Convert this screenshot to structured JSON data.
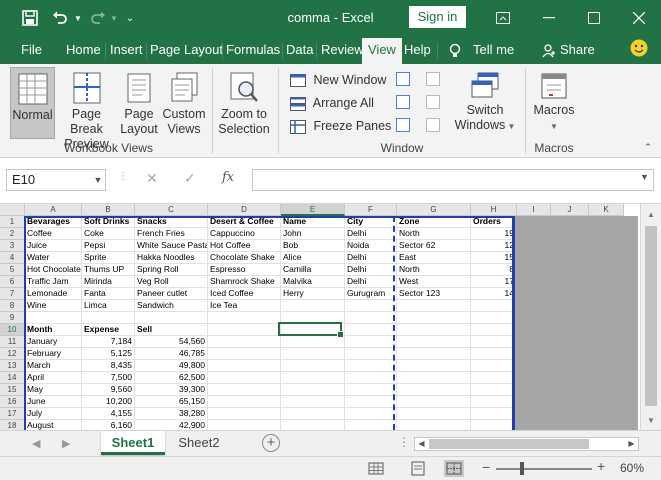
{
  "window": {
    "title": "comma",
    "separator": " - ",
    "app": "Excel",
    "signin_label": "Sign in"
  },
  "tabs": [
    {
      "label": "File"
    },
    {
      "label": "Home"
    },
    {
      "label": "Insert"
    },
    {
      "label": "Page Layout"
    },
    {
      "label": "Formulas"
    },
    {
      "label": "Data"
    },
    {
      "label": "Review"
    },
    {
      "label": "View"
    },
    {
      "label": "Help"
    },
    {
      "label": "Tell me"
    },
    {
      "label": "Share"
    }
  ],
  "ribbon": {
    "workbook_views": {
      "label": "Workbook Views",
      "normal": "Normal",
      "page_break_1": "Page Break",
      "page_break_2": "Preview",
      "page_layout_1": "Page",
      "page_layout_2": "Layout",
      "custom_views_1": "Custom",
      "custom_views_2": "Views"
    },
    "zoom": {
      "zoom_to_selection_1": "Zoom to",
      "zoom_to_selection_2": "Selection"
    },
    "window": {
      "label": "Window",
      "new_window": "New Window",
      "arrange_all": "Arrange All",
      "freeze_panes": "Freeze Panes",
      "switch_windows_1": "Switch",
      "switch_windows_2": "Windows"
    },
    "macros": {
      "label": "Macros",
      "macros_button": "Macros"
    }
  },
  "formula_bar": {
    "name_box": "E10",
    "formula": ""
  },
  "columns": [
    "A",
    "B",
    "C",
    "D",
    "E",
    "F",
    "G",
    "H",
    "I",
    "J",
    "K"
  ],
  "rows": [
    "1",
    "2",
    "3",
    "4",
    "5",
    "6",
    "7",
    "8",
    "9",
    "10",
    "11",
    "12",
    "13",
    "14",
    "15",
    "16",
    "17",
    "18"
  ],
  "selected": {
    "column": "E",
    "row": "10"
  },
  "sheet": {
    "r1": [
      "Bevarages",
      "Soft Drinks",
      "Snacks",
      "Desert & Coffee",
      "Name",
      "City",
      "Zone",
      "Orders"
    ],
    "r2": [
      "Coffee",
      "Coke",
      "French Fries",
      "Cappuccino",
      "John",
      "Delhi",
      "North",
      "19"
    ],
    "r3": [
      "Juice",
      "Pepsi",
      "White Sauce Pasta",
      "Hot Coffee",
      "Bob",
      "Noida",
      "Sector 62",
      "12"
    ],
    "r4": [
      "Water",
      "Sprite",
      "Hakka Noodles",
      "Chocolate Shake",
      "Alice",
      "Delhi",
      "East",
      "15"
    ],
    "r5": [
      "Hot Chocolate",
      "Thums UP",
      "Spring Roll",
      "Espresso",
      "Camilla",
      "Delhi",
      "North",
      "8"
    ],
    "r6": [
      "Traffic Jam",
      "Mirinda",
      "Veg Roll",
      "Shamrock Shake",
      "Malvika",
      "Delhi",
      "West",
      "17"
    ],
    "r7": [
      "Lemonade",
      "Fanta",
      "Paneer cutlet",
      "Iced Coffee",
      "Herry",
      "Gurugram",
      "Sector 123",
      "14"
    ],
    "r8": [
      "Wine",
      "Limca",
      "Sandwich",
      "Ice Tea"
    ],
    "r10": [
      "Month",
      "Expense",
      "Sell"
    ],
    "r11": [
      "January",
      "7,184",
      "54,560"
    ],
    "r12": [
      "February",
      "5,125",
      "46,785"
    ],
    "r13": [
      "March",
      "8,435",
      "49,800"
    ],
    "r14": [
      "April",
      "7,500",
      "62,500"
    ],
    "r15": [
      "May",
      "9,560",
      "39,300"
    ],
    "r16": [
      "June",
      "10,200",
      "65,150"
    ],
    "r17": [
      "July",
      "4,155",
      "38,280"
    ],
    "r18": [
      "August",
      "6,160",
      "42,900"
    ]
  },
  "sheet_tabs": [
    {
      "label": "Sheet1",
      "active": true
    },
    {
      "label": "Sheet2",
      "active": false
    }
  ],
  "status": {
    "zoom_level": "60%",
    "zoom_percent": 60
  },
  "colors": {
    "accent": "#217346",
    "page_break": "#1f3fae",
    "outside_print_area": "#a6a6a6"
  }
}
